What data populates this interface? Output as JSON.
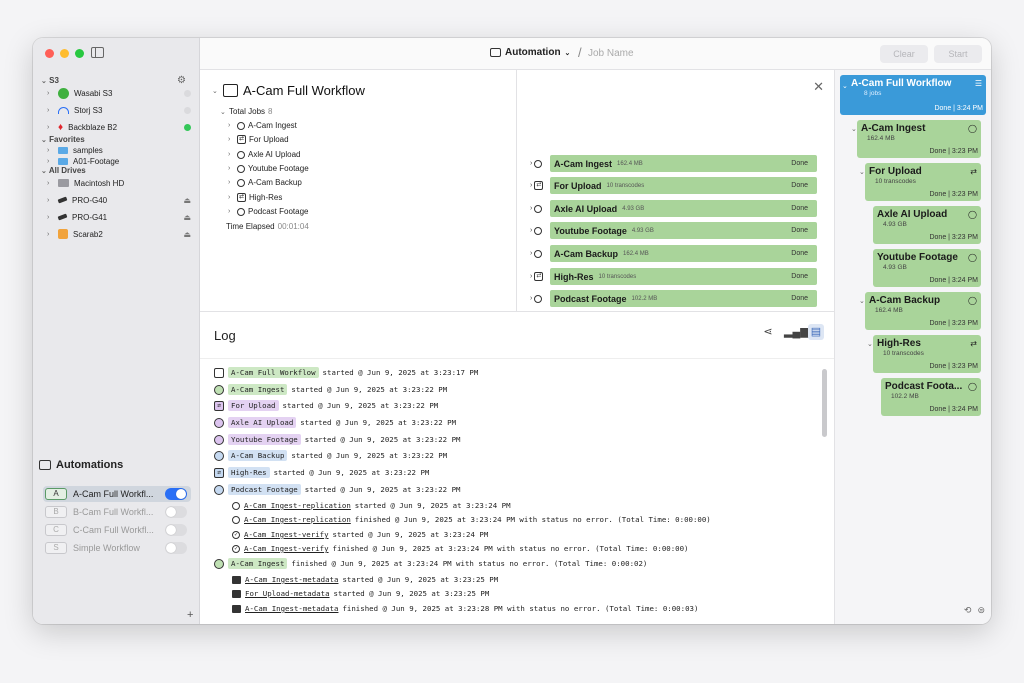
{
  "sidebar": {
    "sections": {
      "s3": "S3",
      "favorites": "Favorites",
      "all_drives": "All Drives"
    },
    "s3_items": [
      {
        "label": "Wasabi S3",
        "status": "idle"
      },
      {
        "label": "Storj S3",
        "status": "idle"
      },
      {
        "label": "Backblaze B2",
        "status": "online"
      }
    ],
    "favorites": [
      {
        "label": "samples"
      },
      {
        "label": "A01-Footage"
      }
    ],
    "drives": [
      {
        "label": "Macintosh HD",
        "eject": false
      },
      {
        "label": "PRO-G40",
        "eject": true
      },
      {
        "label": "PRO-G41",
        "eject": true
      },
      {
        "label": "Scarab2",
        "eject": true
      }
    ],
    "automations_title": "Automations",
    "automations": [
      {
        "letter": "A",
        "label": "A-Cam Full Workfl...",
        "enabled": true
      },
      {
        "letter": "B",
        "label": "B-Cam Full Workfl...",
        "enabled": false
      },
      {
        "letter": "C",
        "label": "C-Cam Full Workfl...",
        "enabled": false
      },
      {
        "letter": "S",
        "label": "Simple Workflow",
        "enabled": false
      }
    ],
    "add_label": "+"
  },
  "toolbar": {
    "automation_label": "Automation",
    "job_name_placeholder": "Job Name",
    "clear_label": "Clear",
    "start_label": "Start"
  },
  "job": {
    "title": "A-Cam Full Workflow",
    "total_jobs_label": "Total Jobs",
    "total_jobs_value": "8",
    "items": [
      {
        "label": "A-Cam Ingest",
        "kind": "copy"
      },
      {
        "label": "For Upload",
        "kind": "transcode"
      },
      {
        "label": "Axle AI Upload",
        "kind": "copy"
      },
      {
        "label": "Youtube Footage",
        "kind": "copy"
      },
      {
        "label": "A-Cam Backup",
        "kind": "copy"
      },
      {
        "label": "High-Res",
        "kind": "transcode"
      },
      {
        "label": "Podcast Footage",
        "kind": "copy"
      }
    ],
    "elapsed_label": "Time Elapsed",
    "elapsed_value": "00:01:04"
  },
  "stages": [
    {
      "name": "A-Cam Ingest",
      "size": "162.4 MB",
      "status": "Done",
      "kind": "copy"
    },
    {
      "name": "For Upload",
      "size": "10 transcodes",
      "status": "Done",
      "kind": "transcode"
    },
    {
      "name": "Axle AI Upload",
      "size": "4.93 GB",
      "status": "Done",
      "kind": "copy"
    },
    {
      "name": "Youtube Footage",
      "size": "4.93 GB",
      "status": "Done",
      "kind": "copy"
    },
    {
      "name": "A-Cam Backup",
      "size": "162.4 MB",
      "status": "Done",
      "kind": "copy"
    },
    {
      "name": "High-Res",
      "size": "10 transcodes",
      "status": "Done",
      "kind": "transcode"
    },
    {
      "name": "Podcast Footage",
      "size": "102.2 MB",
      "status": "Done",
      "kind": "copy"
    }
  ],
  "log": {
    "title": "Log",
    "lines": [
      {
        "tag": "A-Cam Full Workflow",
        "tagstyle": "green",
        "icon": "workflow",
        "text": "started @ Jun 9, 2025 at 3:23:17 PM",
        "indent": false
      },
      {
        "tag": "A-Cam Ingest",
        "tagstyle": "green",
        "icon": "circle-g",
        "text": "started @ Jun 9, 2025 at 3:23:22 PM",
        "indent": false
      },
      {
        "tag": "For Upload",
        "tagstyle": "purple",
        "icon": "trans",
        "text": "started @ Jun 9, 2025 at 3:23:22 PM",
        "indent": false
      },
      {
        "tag": "Axle AI Upload",
        "tagstyle": "purple",
        "icon": "circle-p",
        "text": "started @ Jun 9, 2025 at 3:23:22 PM",
        "indent": false
      },
      {
        "tag": "Youtube Footage",
        "tagstyle": "purple",
        "icon": "circle-p",
        "text": "started @ Jun 9, 2025 at 3:23:22 PM",
        "indent": false
      },
      {
        "tag": "A-Cam Backup",
        "tagstyle": "blue",
        "icon": "circle-b",
        "text": "started @ Jun 9, 2025 at 3:23:22 PM",
        "indent": false
      },
      {
        "tag": "High-Res",
        "tagstyle": "blue",
        "icon": "trans",
        "text": "started @ Jun 9, 2025 at 3:23:22 PM",
        "indent": false
      },
      {
        "tag": "Podcast Footage",
        "tagstyle": "blue",
        "icon": "circle-b",
        "text": "started @ Jun 9, 2025 at 3:23:22 PM",
        "indent": false
      },
      {
        "tag": "A-Cam Ingest-replication",
        "tagstyle": "ul",
        "icon": "small-circle",
        "text": "started @ Jun 9, 2025 at 3:23:24 PM",
        "indent": true
      },
      {
        "tag": "A-Cam Ingest-replication",
        "tagstyle": "ul",
        "icon": "small-circle",
        "text": "finished @ Jun 9, 2025 at 3:23:24 PM with status no error. (Total Time: 0:00:00)",
        "indent": true
      },
      {
        "tag": "A-Cam Ingest-verify",
        "tagstyle": "ul",
        "icon": "check",
        "text": "started @ Jun 9, 2025 at 3:23:24 PM",
        "indent": true
      },
      {
        "tag": "A-Cam Ingest-verify",
        "tagstyle": "ul",
        "icon": "check",
        "text": "finished @ Jun 9, 2025 at 3:23:24 PM with status no error. (Total Time: 0:00:00)",
        "indent": true
      },
      {
        "tag": "A-Cam Ingest",
        "tagstyle": "green",
        "icon": "circle-g",
        "text": "finished @ Jun 9, 2025 at 3:23:24 PM with status no error. (Total Time: 0:00:02)",
        "indent": false
      },
      {
        "tag": "A-Cam Ingest-metadata",
        "tagstyle": "ul",
        "icon": "image",
        "text": "started @ Jun 9, 2025 at 3:23:25 PM",
        "indent": true
      },
      {
        "tag": "For Upload-metadata",
        "tagstyle": "ul",
        "icon": "image",
        "text": "started @ Jun 9, 2025 at 3:23:25 PM",
        "indent": true
      },
      {
        "tag": "A-Cam Ingest-metadata",
        "tagstyle": "ul",
        "icon": "image",
        "text": "finished @ Jun 9, 2025 at 3:23:28 PM with status no error. (Total Time: 0:00:03)",
        "indent": true
      }
    ]
  },
  "queue": {
    "top": {
      "title": "A-Cam Full Workflow",
      "sub": "8 jobs",
      "done": "Done | 3:24 PM"
    },
    "cards": [
      {
        "title": "A-Cam Ingest",
        "sub": "162.4 MB",
        "done": "Done | 3:23 PM",
        "kind": "copy"
      },
      {
        "title": "For Upload",
        "sub": "10 transcodes",
        "done": "Done | 3:23 PM",
        "kind": "transcode"
      },
      {
        "title": "Axle AI Upload",
        "sub": "4.93 GB",
        "done": "Done | 3:23 PM",
        "kind": "copy"
      },
      {
        "title": "Youtube Footage",
        "sub": "4.93 GB",
        "done": "Done | 3:24 PM",
        "kind": "copy"
      },
      {
        "title": "A-Cam Backup",
        "sub": "162.4 MB",
        "done": "Done | 3:23 PM",
        "kind": "copy"
      },
      {
        "title": "High-Res",
        "sub": "10 transcodes",
        "done": "Done | 3:23 PM",
        "kind": "transcode"
      },
      {
        "title": "Podcast Foota...",
        "sub": "102.2 MB",
        "done": "Done | 3:24 PM",
        "kind": "copy"
      }
    ]
  },
  "colors": {
    "accent": "#2a6ff5",
    "stage_done": "#a9d49a",
    "queue_top": "#3a9ad9",
    "online": "#34c759"
  }
}
